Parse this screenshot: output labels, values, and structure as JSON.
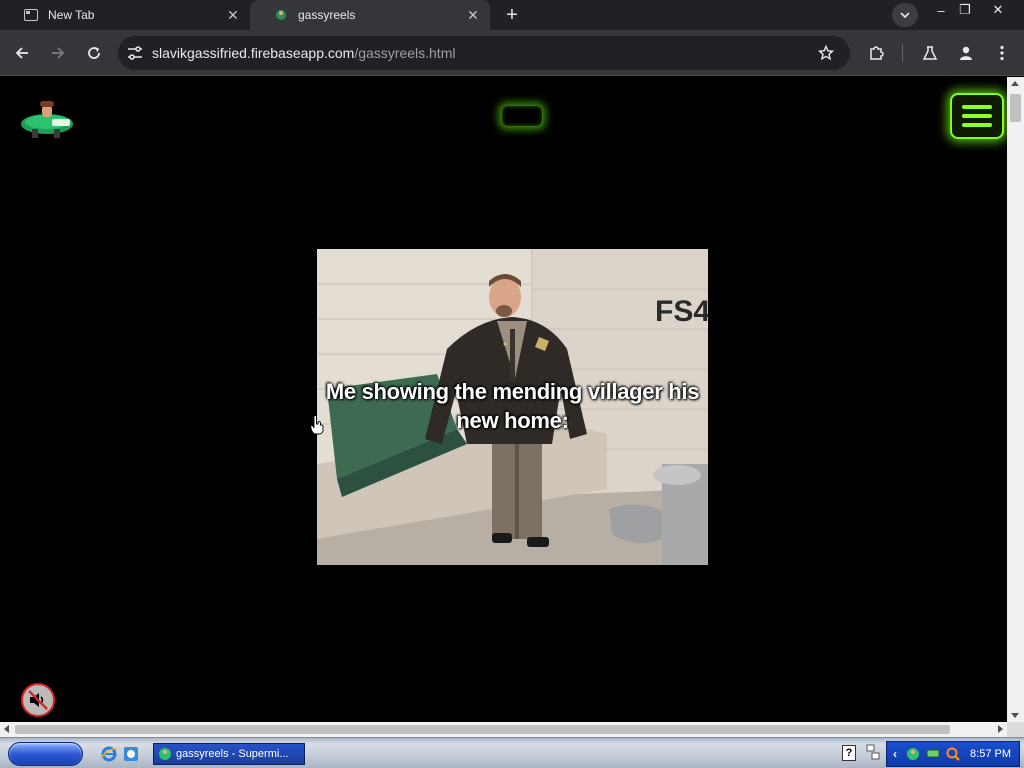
{
  "browser": {
    "tabs": [
      {
        "label": "New Tab",
        "icon": "new-tab-icon",
        "active": false
      },
      {
        "label": "gassyreels",
        "icon": "site-favicon",
        "active": true
      }
    ],
    "new_tab_symbol": "+",
    "window_controls": {
      "minimize": "–",
      "restore": "❐",
      "close": "✕"
    },
    "address": {
      "host": "slavikgassifried.firebaseapp.com",
      "path": "/gassyreels.html"
    },
    "colors": {
      "tabstrip": "#202124",
      "toolbar": "#35363a",
      "omnibox": "#202124"
    }
  },
  "page": {
    "accent_color": "#7cff1c",
    "video": {
      "caption": "Me showing the mending villager his new home:",
      "scene_label": "FS4"
    },
    "mute_button": {
      "state": "muted",
      "icon": "speaker-muted-icon"
    }
  },
  "taskbar": {
    "task_label": "gassyreels - Supermi...",
    "help_symbol": "?",
    "clock": "8:57 PM",
    "tray_arrow": "‹"
  }
}
